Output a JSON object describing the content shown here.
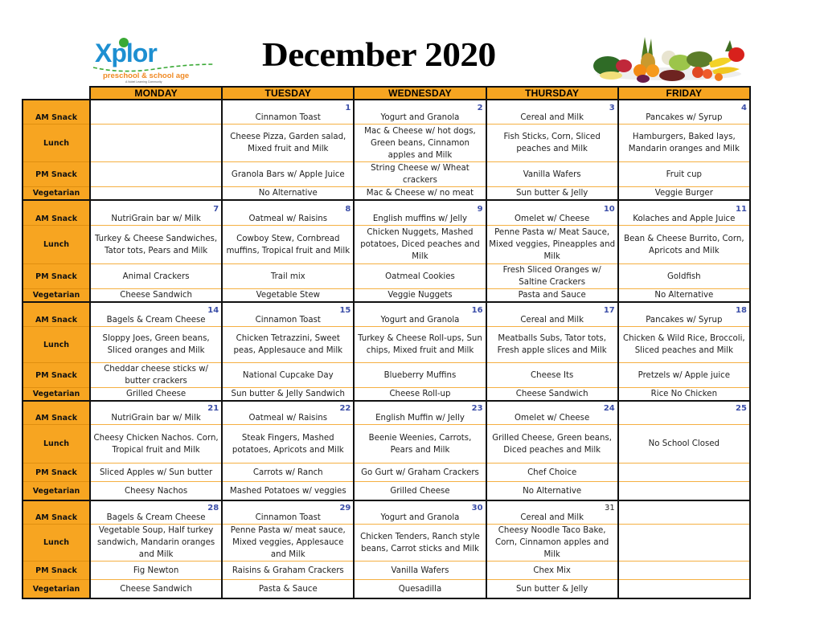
{
  "header": {
    "logo": {
      "brand": "Xplor",
      "tagline": "preschool & school age",
      "subtagline": "A Nobel Learning Community"
    },
    "title": "December 2020",
    "image": "fruits-and-vegetables"
  },
  "colors": {
    "header_fill": "#f7a521",
    "date_number": "#3b4ea8",
    "row_divider": "#f5b042",
    "border": "#111111"
  },
  "days": [
    "MONDAY",
    "TUESDAY",
    "WEDNESDAY",
    "THURSDAY",
    "FRIDAY"
  ],
  "row_labels": {
    "am": "AM Snack",
    "lunch": "Lunch",
    "pm": "PM Snack",
    "veg": "Vegetarian"
  },
  "weeks": [
    {
      "dates": [
        "",
        "1",
        "2",
        "3",
        "4"
      ],
      "am": [
        "",
        "Cinnamon Toast",
        "Yogurt and Granola",
        "Cereal and Milk",
        "Pancakes w/ Syrup"
      ],
      "lunch": [
        "",
        "Cheese Pizza, Garden salad, Mixed fruit and Milk",
        "Mac & Cheese w/ hot dogs, Green beans, Cinnamon apples and Milk",
        "Fish Sticks, Corn, Sliced peaches and Milk",
        "Hamburgers, Baked lays, Mandarin oranges and Milk"
      ],
      "pm": [
        "",
        "Granola Bars w/ Apple Juice",
        "String Cheese w/ Wheat crackers",
        "Vanilla Wafers",
        "Fruit cup"
      ],
      "veg": [
        "",
        "No Alternative",
        "Mac & Cheese w/ no meat",
        "Sun butter & Jelly",
        "Veggie Burger"
      ]
    },
    {
      "dates": [
        "7",
        "8",
        "9",
        "10",
        "11"
      ],
      "am": [
        "NutriGrain bar w/ Milk",
        "Oatmeal w/ Raisins",
        "English muffins w/ Jelly",
        "Omelet w/ Cheese",
        "Kolaches and Apple Juice"
      ],
      "lunch": [
        "Turkey & Cheese Sandwiches, Tator tots, Pears and Milk",
        "Cowboy Stew, Cornbread muffins, Tropical fruit and Milk",
        "Chicken Nuggets, Mashed potatoes, Diced peaches and Milk",
        "Penne Pasta w/ Meat Sauce, Mixed veggies, Pineapples and Milk",
        "Bean & Cheese Burrito, Corn, Apricots and Milk"
      ],
      "pm": [
        "Animal Crackers",
        "Trail mix",
        "Oatmeal Cookies",
        "Fresh Sliced Oranges w/ Saltine Crackers",
        "Goldfish"
      ],
      "veg": [
        "Cheese Sandwich",
        "Vegetable Stew",
        "Veggie Nuggets",
        "Pasta and Sauce",
        "No Alternative"
      ]
    },
    {
      "dates": [
        "14",
        "15",
        "16",
        "17",
        "18"
      ],
      "am": [
        "Bagels & Cream Cheese",
        "Cinnamon Toast",
        "Yogurt and Granola",
        "Cereal and Milk",
        "Pancakes w/ Syrup"
      ],
      "lunch": [
        "Sloppy Joes, Green beans, Sliced oranges and Milk",
        "Chicken Tetrazzini, Sweet peas, Applesauce and Milk",
        "Turkey & Cheese Roll-ups, Sun chips, Mixed fruit and Milk",
        "Meatballs Subs, Tator tots, Fresh apple slices and Milk",
        "Chicken & Wild Rice, Broccoli, Sliced peaches and Milk"
      ],
      "pm": [
        "Cheddar cheese sticks w/ butter crackers",
        "National Cupcake Day",
        "Blueberry Muffins",
        "Cheese Its",
        "Pretzels w/ Apple juice"
      ],
      "veg": [
        "Grilled Cheese",
        "Sun butter & Jelly Sandwich",
        "Cheese Roll-up",
        "Cheese Sandwich",
        "Rice No Chicken"
      ]
    },
    {
      "dates": [
        "21",
        "22",
        "23",
        "24",
        "25"
      ],
      "am": [
        "NutriGrain bar w/ Milk",
        "Oatmeal w/ Raisins",
        "English Muffin w/ Jelly",
        "Omelet w/ Cheese",
        ""
      ],
      "lunch": [
        "Cheesy Chicken Nachos. Corn, Tropical fruit and Milk",
        "Steak Fingers, Mashed potatoes, Apricots and Milk",
        "Beenie Weenies, Carrots, Pears and Milk",
        "Grilled Cheese, Green beans, Diced peaches and Milk",
        "No School Closed"
      ],
      "pm": [
        "Sliced Apples w/ Sun butter",
        "Carrots w/ Ranch",
        "Go Gurt w/ Graham Crackers",
        "Chef Choice",
        ""
      ],
      "veg": [
        "Cheesy Nachos",
        "Mashed Potatoes w/ veggies",
        "Grilled Cheese",
        "No Alternative",
        ""
      ]
    },
    {
      "dates": [
        "28",
        "29",
        "30",
        "31",
        ""
      ],
      "am": [
        "Bagels & Cream Cheese",
        "Cinnamon Toast",
        "Yogurt and Granola",
        "Cereal and Milk",
        ""
      ],
      "lunch": [
        "Vegetable Soup, Half turkey sandwich, Mandarin oranges and Milk",
        "Penne Pasta w/ meat sauce, Mixed veggies, Applesauce and Milk",
        "Chicken Tenders, Ranch style beans, Carrot sticks and Milk",
        "Cheesy Noodle Taco Bake, Corn, Cinnamon apples and Milk",
        ""
      ],
      "pm": [
        "Fig Newton",
        "Raisins & Graham Crackers",
        "Vanilla Wafers",
        "Chex Mix",
        ""
      ],
      "veg": [
        "Cheese Sandwich",
        "Pasta & Sauce",
        "Quesadilla",
        "Sun butter & Jelly",
        ""
      ]
    }
  ]
}
